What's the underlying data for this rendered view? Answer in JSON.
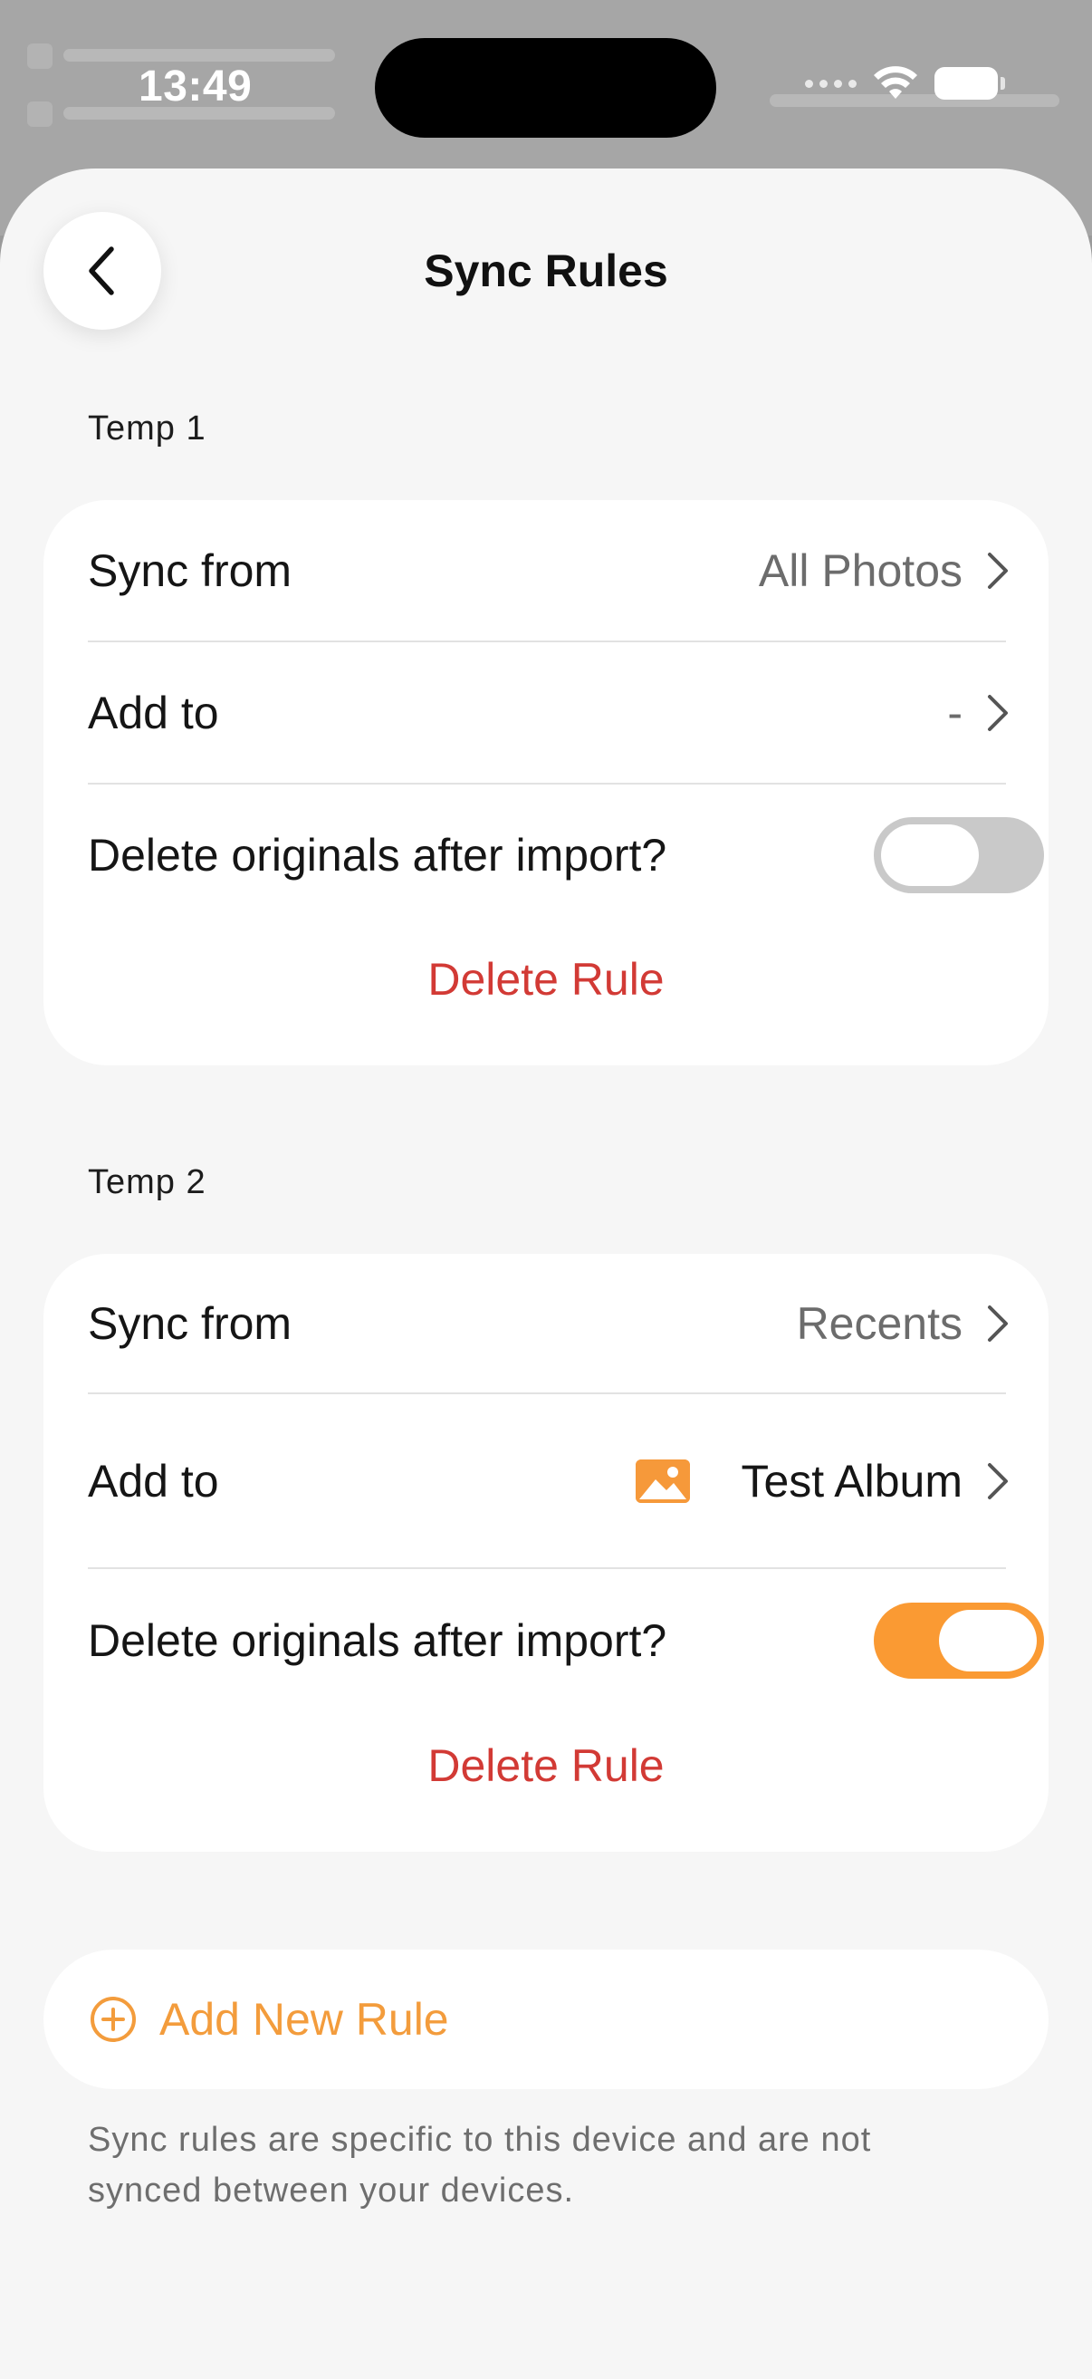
{
  "status_bar": {
    "time": "13:49",
    "wifi_icon": "wifi-icon",
    "battery_icon": "battery-icon"
  },
  "header": {
    "title": "Sync Rules",
    "back_icon": "chevron-left-icon"
  },
  "rules": [
    {
      "name": "Temp 1",
      "sync_from_label": "Sync from",
      "sync_from_value": "All Photos",
      "add_to_label": "Add to",
      "add_to_value": "-",
      "delete_originals_label": "Delete originals after import?",
      "delete_originals": false,
      "delete_rule_label": "Delete Rule"
    },
    {
      "name": "Temp 2",
      "sync_from_label": "Sync from",
      "sync_from_value": "Recents",
      "add_to_label": "Add to",
      "add_to_value": "Test Album",
      "add_to_icon": "photo-album-icon",
      "delete_originals_label": "Delete originals after import?",
      "delete_originals": true,
      "delete_rule_label": "Delete Rule"
    }
  ],
  "add_rule": {
    "label": "Add New Rule",
    "icon": "plus-circle-icon"
  },
  "footnote": "Sync rules are specific to this device and are not synced between your devices.",
  "colors": {
    "accent": "#FA9A33",
    "destructive": "#D23A35",
    "background": "#F6F6F6"
  }
}
